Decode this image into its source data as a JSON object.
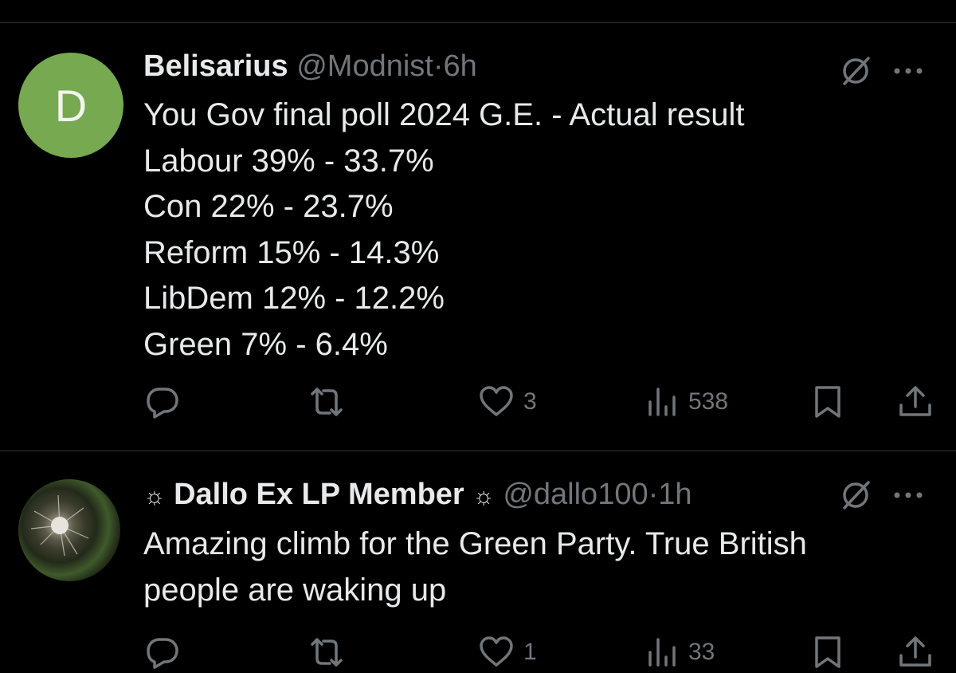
{
  "posts": [
    {
      "avatar_letter": "D",
      "avatar_color": "#76a950",
      "display_name": "Belisarius",
      "handle": "@Modnist",
      "separator": "·",
      "time": "6h",
      "lines": [
        "You Gov final poll 2024 G.E. - Actual result",
        "Labour 39% - 33.7%",
        "Con 22% - 23.7%",
        "Reform 15% - 14.3%",
        "LibDem 12% - 12.2%",
        "Green 7% - 6.4%"
      ],
      "reply_count": "",
      "repost_count": "",
      "like_count": "3",
      "view_count": "538"
    },
    {
      "display_name": "Dallo Ex LP Member",
      "name_decoration": "☼",
      "handle": "@dallo100",
      "separator": "·",
      "time": "1h",
      "lines": [
        "Amazing climb for the Green Party.  True British",
        "people are waking up"
      ],
      "reply_count": "",
      "repost_count": "",
      "like_count": "1",
      "view_count": "33"
    }
  ],
  "icons": {
    "grok": "grok-icon",
    "more": "more-icon",
    "reply": "reply-icon",
    "repost": "repost-icon",
    "like": "heart-icon",
    "views": "views-icon",
    "bookmark": "bookmark-icon",
    "share": "share-icon"
  },
  "colors": {
    "background": "#000000",
    "text": "#e7e9ea",
    "muted": "#71767b",
    "divider": "#2f3336"
  }
}
